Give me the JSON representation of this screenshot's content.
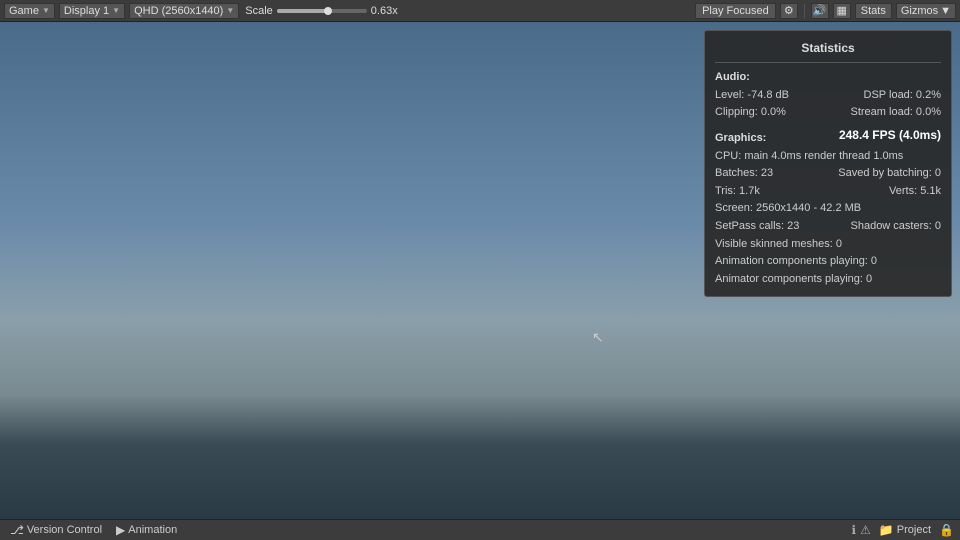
{
  "toolbar": {
    "game_label": "Game",
    "display_label": "Display 1",
    "resolution_label": "QHD (2560x1440)",
    "scale_label": "Scale",
    "scale_value": "0.63x",
    "play_label": "Play Focused",
    "stats_label": "Stats",
    "gizmos_label": "Gizmos"
  },
  "stats": {
    "title": "Statistics",
    "audio_label": "Audio:",
    "level": "Level: -74.8 dB",
    "clipping": "Clipping: 0.0%",
    "dsp_load": "DSP load: 0.2%",
    "stream_load": "Stream load: 0.0%",
    "graphics_label": "Graphics:",
    "fps": "248.4 FPS (4.0ms)",
    "cpu": "CPU: main 4.0ms  render thread 1.0ms",
    "batches": "Batches: 23",
    "saved_by_batching": "Saved by batching: 0",
    "tris": "Tris: 1.7k",
    "verts": "Verts: 5.1k",
    "screen": "Screen: 2560x1440 - 42.2 MB",
    "setpass": "SetPass calls: 23",
    "shadow_casters": "Shadow casters: 0",
    "visible_skinned": "Visible skinned meshes: 0",
    "animation_components": "Animation components playing: 0",
    "animator_components": "Animator components playing: 0"
  },
  "bottom": {
    "version_control": "Version Control",
    "animation": "Animation",
    "project": "Project"
  }
}
